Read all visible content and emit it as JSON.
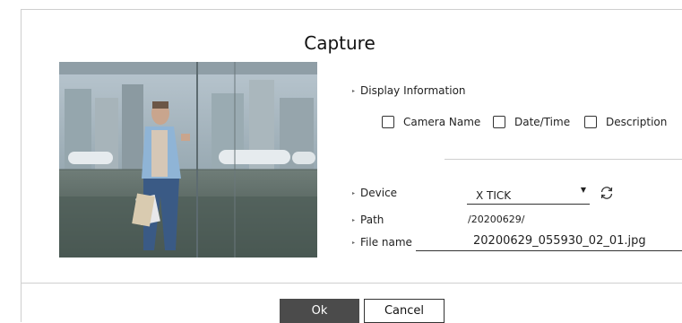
{
  "dialog": {
    "title": "Capture"
  },
  "display_info": {
    "label": "Display Information",
    "options": [
      {
        "label": "Camera Name",
        "checked": false
      },
      {
        "label": "Date/Time",
        "checked": false
      },
      {
        "label": "Description",
        "checked": false
      }
    ]
  },
  "device": {
    "label": "Device",
    "value": "X TICK",
    "arrow": "▼"
  },
  "path": {
    "label": "Path",
    "value": "/20200629/"
  },
  "file_name": {
    "label": "File name",
    "value": "20200629_055930_02_01.jpg"
  },
  "buttons": {
    "ok": "Ok",
    "cancel": "Cancel"
  },
  "colors": {
    "ok_bg": "#4b4b4b",
    "divider": "#cfcfcf"
  },
  "icons": {
    "caret": "▸",
    "refresh": "refresh-icon"
  }
}
